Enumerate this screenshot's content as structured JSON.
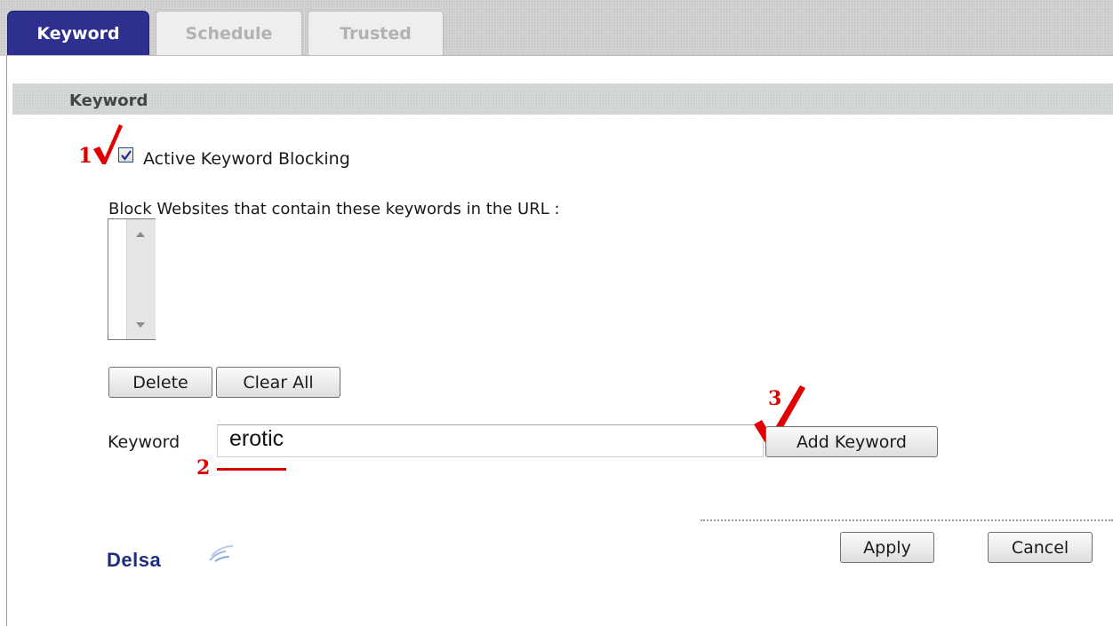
{
  "tabs": [
    {
      "label": "Keyword",
      "active": true
    },
    {
      "label": "Schedule",
      "active": false
    },
    {
      "label": "Trusted",
      "active": false
    }
  ],
  "section": {
    "title": "Keyword"
  },
  "blocking": {
    "label": "Active Keyword Blocking",
    "checked": true
  },
  "list": {
    "label": "Block Websites that contain these keywords in the URL :",
    "items": []
  },
  "buttons": {
    "delete": "Delete",
    "clear_all": "Clear All",
    "add_keyword": "Add Keyword",
    "apply": "Apply",
    "cancel": "Cancel"
  },
  "keyword": {
    "label": "Keyword",
    "value": "erotic"
  },
  "annotations": {
    "step1": "1",
    "step2": "2",
    "step3": "3"
  },
  "logo": {
    "text": "Delsa"
  },
  "colors": {
    "tab_active": "#2f2f8f",
    "annotation_red": "#e00000",
    "logo_blue": "#1d2f7a"
  }
}
